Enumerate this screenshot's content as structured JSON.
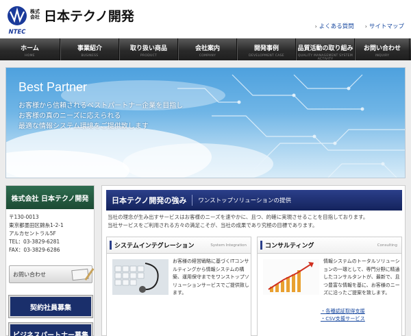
{
  "header": {
    "logo_small": [
      "株式",
      "会社"
    ],
    "logo_text": "日本テクノ開発",
    "logo_mark": "NTEC",
    "links": [
      {
        "label": "よくある質問"
      },
      {
        "label": "サイトマップ"
      }
    ]
  },
  "nav": {
    "items": [
      {
        "label": "ホーム",
        "sub": "HOME"
      },
      {
        "label": "事業紹介",
        "sub": "BUSINESS"
      },
      {
        "label": "取り扱い商品",
        "sub": "PRODUCT"
      },
      {
        "label": "会社案内",
        "sub": "COMPANY"
      },
      {
        "label": "開発事例",
        "sub": "DEVELOPMENT CASE"
      },
      {
        "label": "品質活動の取り組み",
        "sub": "QUALITY MANAGEMENT SYSTEM ACTIVITY"
      },
      {
        "label": "お問い合わせ",
        "sub": "INQUIRY"
      }
    ]
  },
  "hero": {
    "title": "Best Partner",
    "lines": [
      "お客様から信頼されるベストパートナー企業を目指し",
      "お客様の真のニーズに応えられる",
      "最適な情報システム環境をご提供致します"
    ]
  },
  "sidebar": {
    "title": "株式会社 日本テクノ開発",
    "address": [
      "〒130-0013",
      "東京都墨田区錦糸1-2-1",
      "アルカセントラル5F",
      "TEL：03-3829-6281",
      "FAX：03-3829-6286"
    ],
    "inquiry_label": "お問い合わせ",
    "recruit": [
      "契約社員募集",
      "ビジネスパートナー募集"
    ]
  },
  "main": {
    "strength_title": "日本テクノ開発の強み",
    "strength_sub": "ワンストップソリューションの提供",
    "intro": [
      "当社の理念が生み出すサービスはお客様のニーズを速やかに、且つ、的確に実現させることを目指しております。",
      "当社サービスをご利用される方々の満足こそが、当社の成果であり究極の目標であります。"
    ],
    "cards": [
      {
        "title": "システムインテグレーション",
        "en": "System Integration",
        "text": "お客様の経営戦略に基づくITコンサルティングから情報システムの構築、運用保守までをワンストップソリューションサービスでご提供致します。"
      },
      {
        "title": "コンサルティング",
        "en": "Consulting",
        "text": "情報システムのトータルソリューションの一環として、専門分野に精通したコンサルタントが、最新で、且つ豊富な情報を基に、お客様のニーズに沿ったご提案を致します。",
        "links": [
          "・各種認証取得支援",
          "・CSV支援サービス"
        ]
      }
    ]
  },
  "colors": {
    "nav_bg": "#2a2a2a",
    "accent_navy": "#1a2f6b",
    "accent_green": "#1d4b34",
    "link": "#1a4aa0"
  }
}
